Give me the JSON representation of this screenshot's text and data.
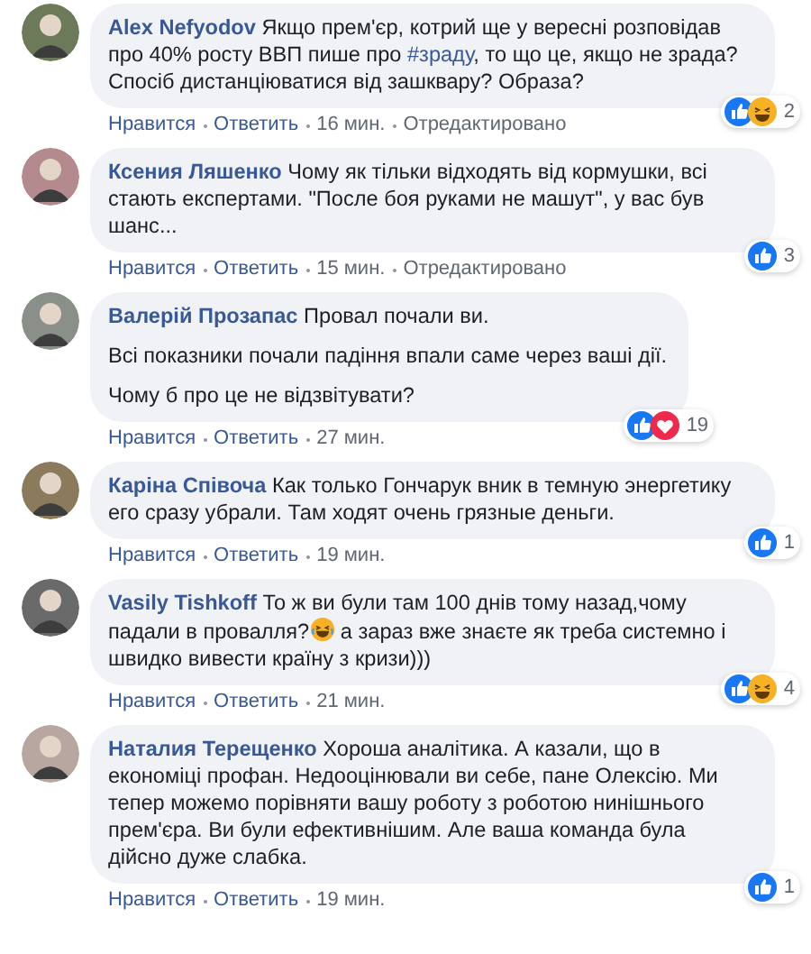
{
  "comments": [
    {
      "author": "Alex Nefyodov",
      "paragraphs": [
        [
          {
            "kind": "text",
            "text": "Якщо прем'єр, котрий ще у вересні розповідав про 40% росту ВВП пише про "
          },
          {
            "kind": "hashtag",
            "text": "#зраду"
          },
          {
            "kind": "text",
            "text": ", то що це, якщо не зрада? Спосіб дистанціюватися від зашквару? Образа?"
          }
        ]
      ],
      "reactions": [
        {
          "kind": "like"
        },
        {
          "kind": "haha"
        }
      ],
      "reaction_count": "2",
      "actions": {
        "like": "Нравится",
        "reply": "Ответить",
        "time": "16 мин.",
        "edited": "Отредактировано"
      }
    },
    {
      "author": "Ксения Ляшенко",
      "paragraphs": [
        [
          {
            "kind": "text",
            "text": "Чому як тільки відходять від кормушки, всі стають експертами. \"После боя руками не машут\", у вас був шанс..."
          }
        ]
      ],
      "reactions": [
        {
          "kind": "like"
        }
      ],
      "reaction_count": "3",
      "actions": {
        "like": "Нравится",
        "reply": "Ответить",
        "time": "15 мин.",
        "edited": "Отредактировано"
      }
    },
    {
      "author": "Валерій Прозапас",
      "paragraphs": [
        [
          {
            "kind": "text",
            "text": "Провал почали ви."
          }
        ],
        [
          {
            "kind": "text",
            "text": "Всі показники почали падіння впали саме через ваші дії."
          }
        ],
        [
          {
            "kind": "text",
            "text": "Чому б про це не відзвітувати?"
          }
        ]
      ],
      "reactions": [
        {
          "kind": "like"
        },
        {
          "kind": "love"
        }
      ],
      "reaction_count": "19",
      "actions": {
        "like": "Нравится",
        "reply": "Ответить",
        "time": "27 мин."
      }
    },
    {
      "author": "Каріна Співоча",
      "paragraphs": [
        [
          {
            "kind": "text",
            "text": "Как только Гончарук вник в темную энергетику его сразу убрали. Там ходят очень грязные деньги."
          }
        ]
      ],
      "reactions": [
        {
          "kind": "like"
        }
      ],
      "reaction_count": "1",
      "actions": {
        "like": "Нравится",
        "reply": "Ответить",
        "time": "19 мин."
      }
    },
    {
      "author": "Vasily Tishkoff",
      "paragraphs": [
        [
          {
            "kind": "text",
            "text": "То ж ви були там 100 днів тому назад,чому падали в провалля?"
          },
          {
            "kind": "emoji"
          },
          {
            "kind": "text",
            "text": " а зараз вже знаєте як треба системно і швидко вивести країну з кризи)))"
          }
        ]
      ],
      "reactions": [
        {
          "kind": "like"
        },
        {
          "kind": "haha"
        }
      ],
      "reaction_count": "4",
      "actions": {
        "like": "Нравится",
        "reply": "Ответить",
        "time": "21 мин."
      }
    },
    {
      "author": "Наталия Терещенко",
      "paragraphs": [
        [
          {
            "kind": "text",
            "text": "Хороша аналітика. А казали, що в економіці профан. Недооцінювали ви себе, пане Олексію. Ми тепер можемо порівняти вашу роботу з роботою нинішнього прем'єра. Ви були ефективнішим. Але ваша команда була дійсно дуже слабка."
          }
        ]
      ],
      "reactions": [
        {
          "kind": "like"
        }
      ],
      "reaction_count": "1",
      "actions": {
        "like": "Нравится",
        "reply": "Ответить",
        "time": "19 мин."
      }
    }
  ]
}
